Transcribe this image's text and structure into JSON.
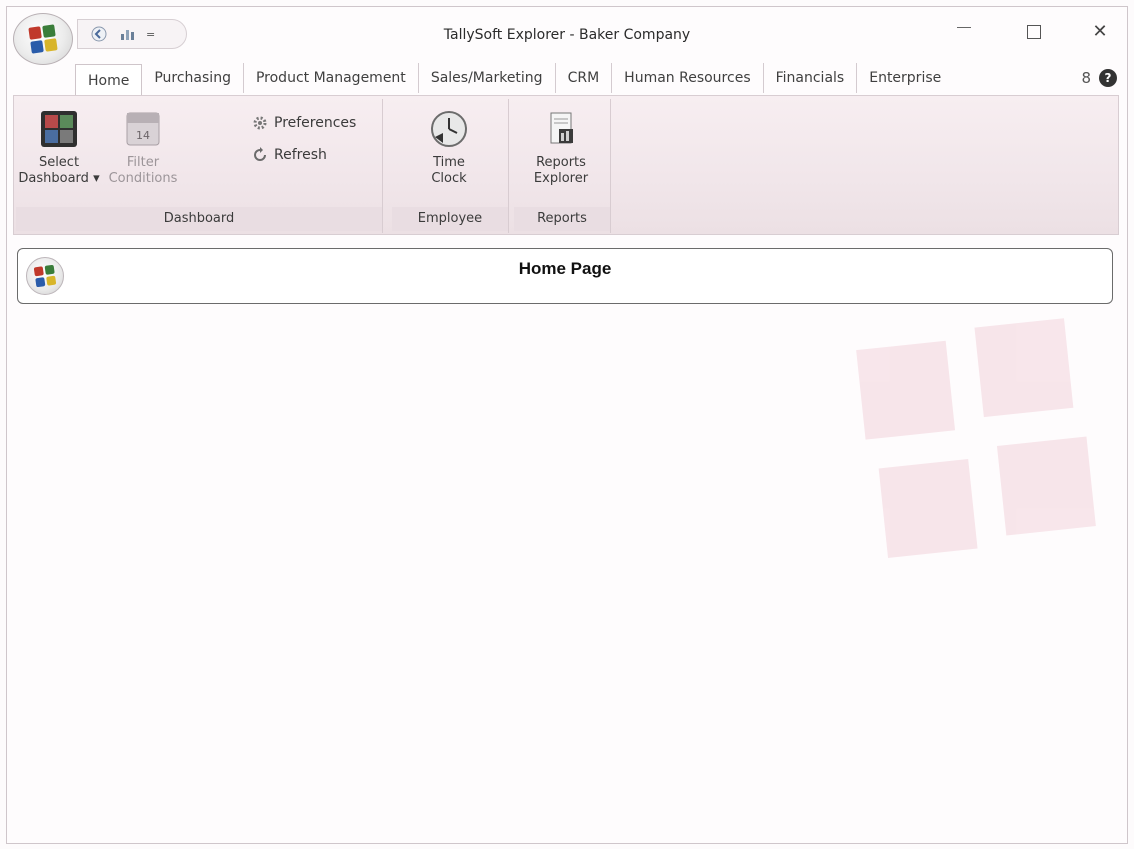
{
  "window": {
    "title": "TallySoft Explorer - Baker Company",
    "qat_dropdown": "="
  },
  "tabs": [
    {
      "label": "Home",
      "active": true
    },
    {
      "label": "Purchasing"
    },
    {
      "label": "Product Management"
    },
    {
      "label": "Sales/Marketing"
    },
    {
      "label": "CRM"
    },
    {
      "label": "Human Resources"
    },
    {
      "label": "Financials"
    },
    {
      "label": "Enterprise"
    }
  ],
  "ribbon": {
    "dashboard": {
      "label": "Dashboard",
      "select_dashboard_line1": "Select",
      "select_dashboard_line2": "Dashboard",
      "filter_line1": "Filter",
      "filter_line2": "Conditions",
      "filter_badge": "14",
      "preferences": "Preferences",
      "refresh": "Refresh"
    },
    "employee": {
      "label": "Employee",
      "time_clock_line1": "Time",
      "time_clock_line2": "Clock"
    },
    "reports": {
      "label": "Reports",
      "reports_explorer_line1": "Reports",
      "reports_explorer_line2": "Explorer"
    }
  },
  "home": {
    "title": "Home Page"
  },
  "icons": {
    "help": "?",
    "key": "8",
    "dropdown_arrow": "▾"
  },
  "colors": {
    "ribbon_bg": "#f1e6ea",
    "logo_red": "#c0392b",
    "logo_green": "#3a7d3a",
    "logo_blue": "#2a5caa",
    "logo_yellow": "#d8b52a"
  }
}
